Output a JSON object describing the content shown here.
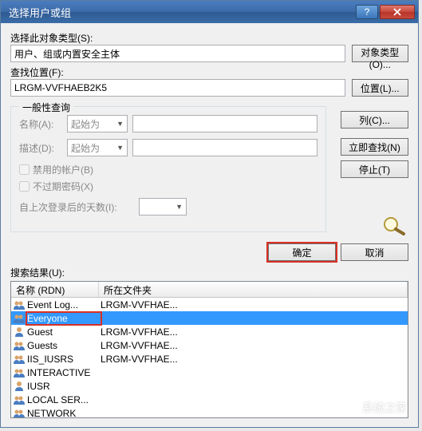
{
  "titlebar": {
    "title": "选择用户或组"
  },
  "section1": {
    "label": "选择此对象类型(S):",
    "value": "用户、组或内置安全主体",
    "btn": "对象类型(O)..."
  },
  "section2": {
    "label": "查找位置(F):",
    "value": "LRGM-VVFHAEB2K5",
    "btn": "位置(L)..."
  },
  "query": {
    "legend": "一般性查询",
    "name_lbl": "名称(A):",
    "name_sel": "起始为",
    "desc_lbl": "描述(D):",
    "desc_sel": "起始为",
    "chk1": "禁用的帐户(B)",
    "chk2": "不过期密码(X)",
    "days_lbl": "自上次登录后的天数(I):"
  },
  "side": {
    "columns": "列(C)...",
    "findnow": "立即查找(N)",
    "stop": "停止(T)"
  },
  "dlg": {
    "ok": "确定",
    "cancel": "取消"
  },
  "results": {
    "label": "搜索结果(U):",
    "col1": "名称 (RDN)",
    "col2": "所在文件夹",
    "rows": [
      {
        "type": "group",
        "name": "Event Log...",
        "folder": "LRGM-VVFHAE..."
      },
      {
        "type": "group",
        "name": "Everyone",
        "folder": "",
        "selected": true,
        "boxed": true
      },
      {
        "type": "user",
        "name": "Guest",
        "folder": "LRGM-VVFHAE..."
      },
      {
        "type": "group",
        "name": "Guests",
        "folder": "LRGM-VVFHAE..."
      },
      {
        "type": "group",
        "name": "IIS_IUSRS",
        "folder": "LRGM-VVFHAE..."
      },
      {
        "type": "group",
        "name": "INTERACTIVE",
        "folder": ""
      },
      {
        "type": "user",
        "name": "IUSR",
        "folder": ""
      },
      {
        "type": "group",
        "name": "LOCAL SER...",
        "folder": ""
      },
      {
        "type": "group",
        "name": "NETWORK",
        "folder": ""
      }
    ]
  },
  "watermark": "系统之家"
}
